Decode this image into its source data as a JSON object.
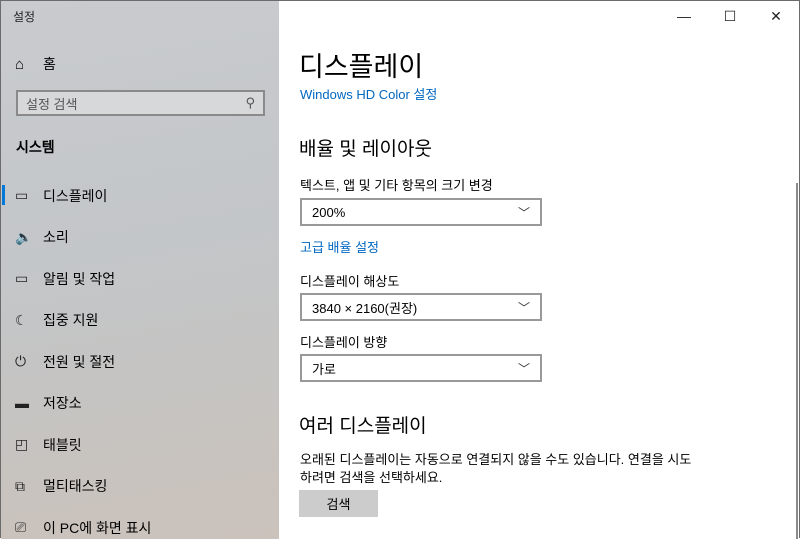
{
  "app_title": "설정",
  "sidebar": {
    "home": "홈",
    "search_placeholder": "설정 검색",
    "section": "시스템",
    "items": [
      {
        "label": "디스플레이",
        "icon": "monitor-icon"
      },
      {
        "label": "소리",
        "icon": "speaker-icon"
      },
      {
        "label": "알림 및 작업",
        "icon": "notification-icon"
      },
      {
        "label": "집중 지원",
        "icon": "moon-icon"
      },
      {
        "label": "전원 및 절전",
        "icon": "power-icon"
      },
      {
        "label": "저장소",
        "icon": "storage-icon"
      },
      {
        "label": "태블릿",
        "icon": "tablet-icon"
      },
      {
        "label": "멀티태스킹",
        "icon": "multitasking-icon"
      },
      {
        "label": "이 PC에 화면 표시",
        "icon": "project-icon"
      }
    ]
  },
  "main": {
    "title": "디스플레이",
    "hd_color_link": "Windows HD Color 설정",
    "scale_section": "배율 및 레이아웃",
    "scale_label": "텍스트, 앱 및 기타 항목의 크기 변경",
    "scale_value": "200%",
    "advanced_scale_link": "고급 배율 설정",
    "resolution_label": "디스플레이 해상도",
    "resolution_value": "3840 × 2160(권장)",
    "orientation_label": "디스플레이 방향",
    "orientation_value": "가로",
    "multi_section": "여러 디스플레이",
    "multi_desc": "오래된 디스플레이는 자동으로 연결되지 않을 수도 있습니다. 연결을 시도하려면 검색을 선택하세요.",
    "detect_button": "검색"
  },
  "accent": "#0078d7"
}
